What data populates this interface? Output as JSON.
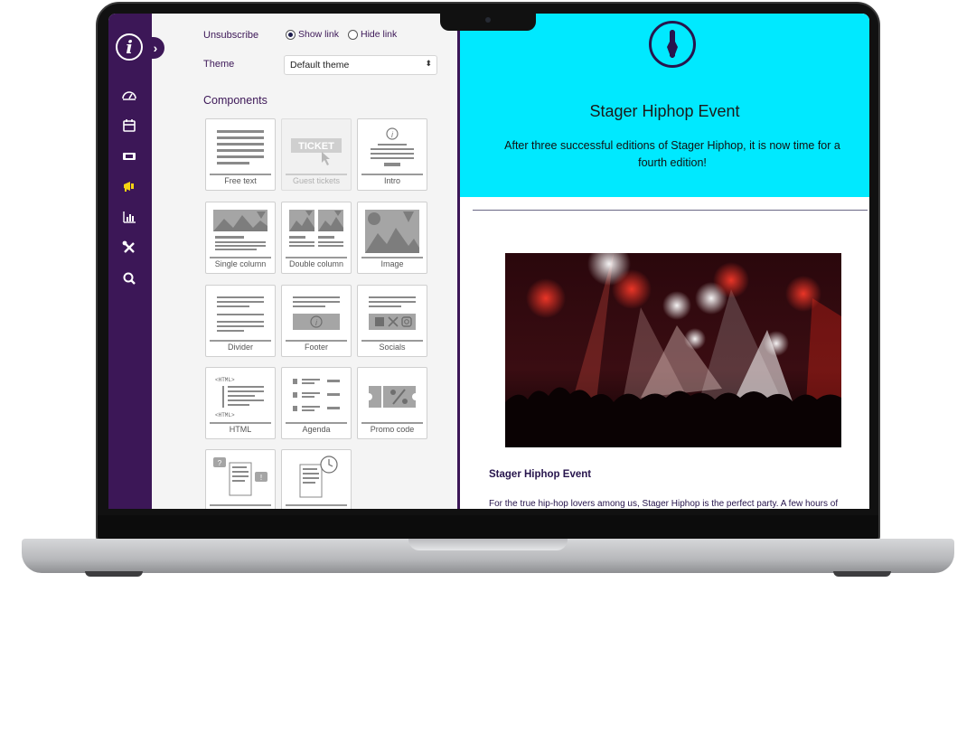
{
  "settings": {
    "unsubscribe_label": "Unsubscribe",
    "unsubscribe_options": [
      {
        "label": "Show link",
        "selected": true
      },
      {
        "label": "Hide link",
        "selected": false
      }
    ],
    "theme_label": "Theme",
    "theme_value": "Default theme",
    "components_title": "Components"
  },
  "components": [
    {
      "label": "Free text",
      "enabled": true
    },
    {
      "label": "Guest tickets",
      "enabled": false,
      "art_text": "TICKET"
    },
    {
      "label": "Intro",
      "enabled": true
    },
    {
      "label": "Single column",
      "enabled": true
    },
    {
      "label": "Double column",
      "enabled": true
    },
    {
      "label": "Image",
      "enabled": true
    },
    {
      "label": "Divider",
      "enabled": true
    },
    {
      "label": "Footer",
      "enabled": true
    },
    {
      "label": "Socials",
      "enabled": true
    },
    {
      "label": "HTML",
      "enabled": true,
      "art_text": "<HTML>"
    },
    {
      "label": "Agenda",
      "enabled": true
    },
    {
      "label": "Promo code",
      "enabled": true
    }
  ],
  "sidebar": {
    "icons": [
      "dashboard-icon",
      "calendar-icon",
      "ticket-icon",
      "megaphone-icon",
      "chart-icon",
      "tools-icon",
      "search-icon"
    ],
    "active": "megaphone-icon"
  },
  "preview": {
    "hero_title": "Stager Hiphop Event",
    "hero_text": "After three successful editions of Stager Hiphop, it is now time for a fourth edition!",
    "event_title": "Stager Hiphop Event",
    "event_text": "For the true hip-hop lovers among us, Stager Hiphop is the perfect party. A few hours of"
  },
  "colors": {
    "sidebar": "#3c1757",
    "accent": "#f5d312",
    "hero_background": "#00e9ff"
  }
}
